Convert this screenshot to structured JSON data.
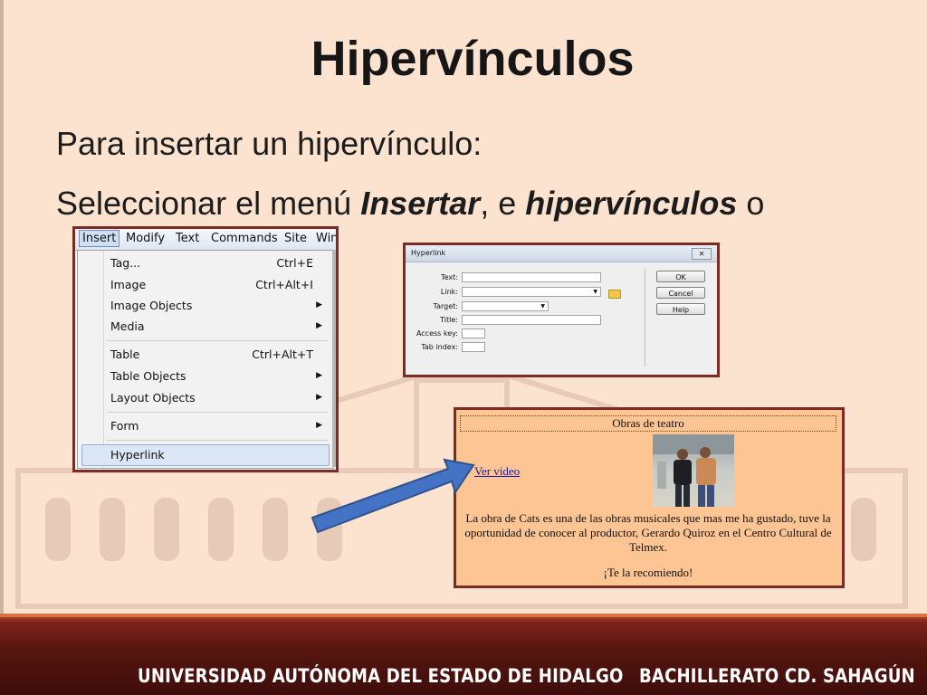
{
  "slide": {
    "title": "Hipervínculos",
    "line1": "Para insertar un hipervínculo:",
    "line2_prefix": "Seleccionar el menú ",
    "line2_bold1": "Insertar",
    "line2_mid": ", e ",
    "line2_bold2": "hipervínculos",
    "line2_suffix": " o"
  },
  "menu_screenshot": {
    "menubar": [
      "Insert",
      "Modify",
      "Text",
      "Commands",
      "Site",
      "Win"
    ],
    "items": [
      {
        "label": "Tag...",
        "shortcut": "Ctrl+E"
      },
      {
        "label": "Image",
        "shortcut": "Ctrl+Alt+I"
      },
      {
        "label": "Image Objects",
        "submenu": true
      },
      {
        "label": "Media",
        "submenu": true
      },
      {
        "label": "Table",
        "shortcut": "Ctrl+Alt+T"
      },
      {
        "label": "Table Objects",
        "submenu": true
      },
      {
        "label": "Layout Objects",
        "submenu": true
      },
      {
        "label": "Form",
        "submenu": true
      },
      {
        "label": "Hyperlink"
      }
    ]
  },
  "dialog": {
    "title": "Hyperlink",
    "close": "✕",
    "labels": {
      "text": "Text:",
      "link": "Link:",
      "target": "Target:",
      "title": "Title:",
      "access_key": "Access key:",
      "tab_index": "Tab index:"
    },
    "values": {
      "text": "",
      "link": "",
      "target": "",
      "title": "",
      "access_key": "",
      "tab_index": ""
    },
    "buttons": {
      "ok": "OK",
      "cancel": "Cancel",
      "help": "Help"
    }
  },
  "page_preview": {
    "header": "Obras de teatro",
    "link_text": "Ver video",
    "body_text": "La obra de Cats es una de las obras musicales que mas me ha gustado, tuve la oportunidad de conocer al productor, Gerardo Quiroz en el Centro Cultural de Telmex.",
    "closing": "¡Te la recomiendo!"
  },
  "footer": {
    "left": "UNIVERSIDAD AUTÓNOMA DEL ESTADO DE HIDALGO",
    "right": "BACHILLERATO CD. SAHAGÚN"
  },
  "colors": {
    "background": "#fbe3cf",
    "frame": "#7a2b24",
    "preview_bg": "#fcc593",
    "arrow_fill": "#4472c4",
    "footer": "#561510"
  }
}
